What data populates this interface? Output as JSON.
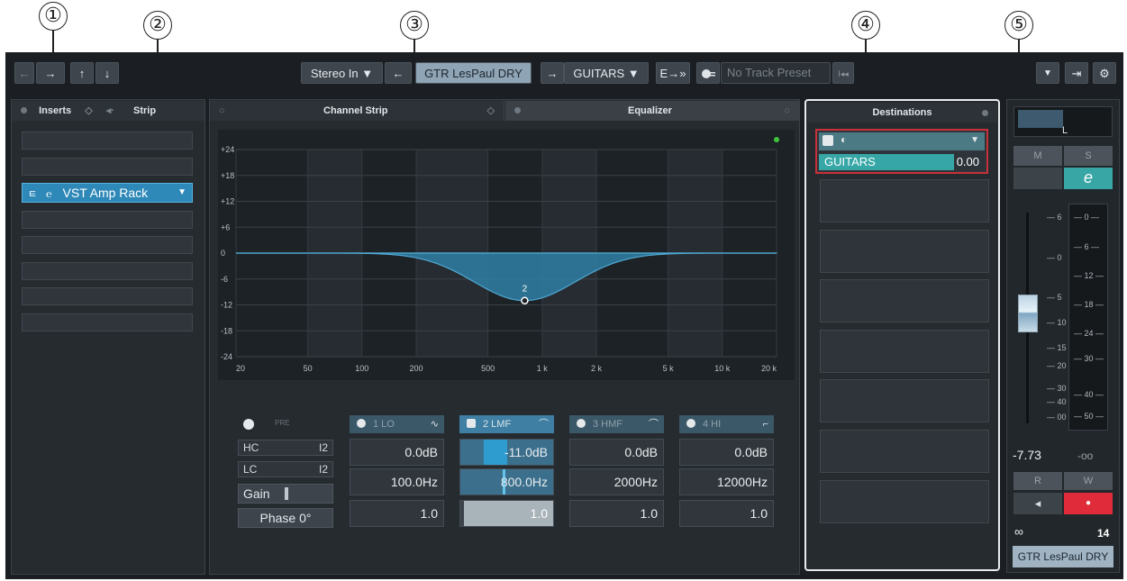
{
  "callouts": [
    "①",
    "②",
    "③",
    "④",
    "⑤"
  ],
  "toolbar": {
    "back_glyph": "←",
    "forward_glyph": "→",
    "up_glyph": "↑",
    "down_glyph": "↓",
    "input_routing": "Stereo In ▼",
    "in_arrow": "←",
    "channel_name": "GTR LesPaul DRY",
    "out_arrow": "→",
    "output_routing": "GUITARS ▼",
    "route_glyph": "E→»",
    "track_preset_placeholder": "No Track Preset",
    "preset_nav": "I◂◂",
    "menu_glyph": "▼",
    "export_glyph": "⇥",
    "settings_glyph": "⚙"
  },
  "left_panel": {
    "tabs": [
      "Inserts",
      "Strip"
    ],
    "insert_plugin": "VST Amp Rack"
  },
  "center_panel": {
    "tabs": [
      "Channel Strip",
      "Equalizer"
    ]
  },
  "eq": {
    "db_ticks": [
      "+24",
      "+18",
      "+12",
      "+6",
      "0",
      "-6",
      "-12",
      "-18",
      "-24"
    ],
    "freq_ticks": [
      "20",
      "50",
      "100",
      "200",
      "500",
      "1 k",
      "2 k",
      "5 k",
      "10 k",
      "20 k"
    ],
    "point_label": "2",
    "point_gain_db": -11.0,
    "point_freq_hz": 800,
    "pre_label": "PRE",
    "hc_label": "HC",
    "hc_value": "I2",
    "lc_label": "LC",
    "lc_value": "I2",
    "gain_label": "Gain",
    "phase_label": "Phase 0°",
    "bands": [
      {
        "name": "1 LO",
        "gain": "0.0dB",
        "freq": "100.0Hz",
        "q": "1.0",
        "shape": "∿"
      },
      {
        "name": "2 LMF",
        "gain": "-11.0dB",
        "freq": "800.0Hz",
        "q": "1.0",
        "shape": "⌒"
      },
      {
        "name": "3 HMF",
        "gain": "0.0dB",
        "freq": "2000Hz",
        "q": "1.0",
        "shape": "⌒"
      },
      {
        "name": "4 HI",
        "gain": "0.0dB",
        "freq": "12000Hz",
        "q": "1.0",
        "shape": "⌐"
      }
    ]
  },
  "destinations": {
    "title": "Destinations",
    "send_name": "GUITARS",
    "send_value": "0.00"
  },
  "channel": {
    "pan_label": "L",
    "mute": "M",
    "solo": "S",
    "edit": "e",
    "fader_scale": [
      "6",
      "0",
      "5",
      "10",
      "15",
      "20",
      "30",
      "40",
      "00"
    ],
    "meter_scale": [
      "0",
      "6",
      "12",
      "18",
      "24",
      "30",
      "40",
      "50"
    ],
    "volume": "-7.73",
    "peak": "-oo",
    "read": "R",
    "write": "W",
    "monitor_glyph": "◂",
    "record_glyph": "●",
    "link_glyph": "∞",
    "channel_number": "14",
    "channel_name": "GTR LesPaul DRY"
  }
}
